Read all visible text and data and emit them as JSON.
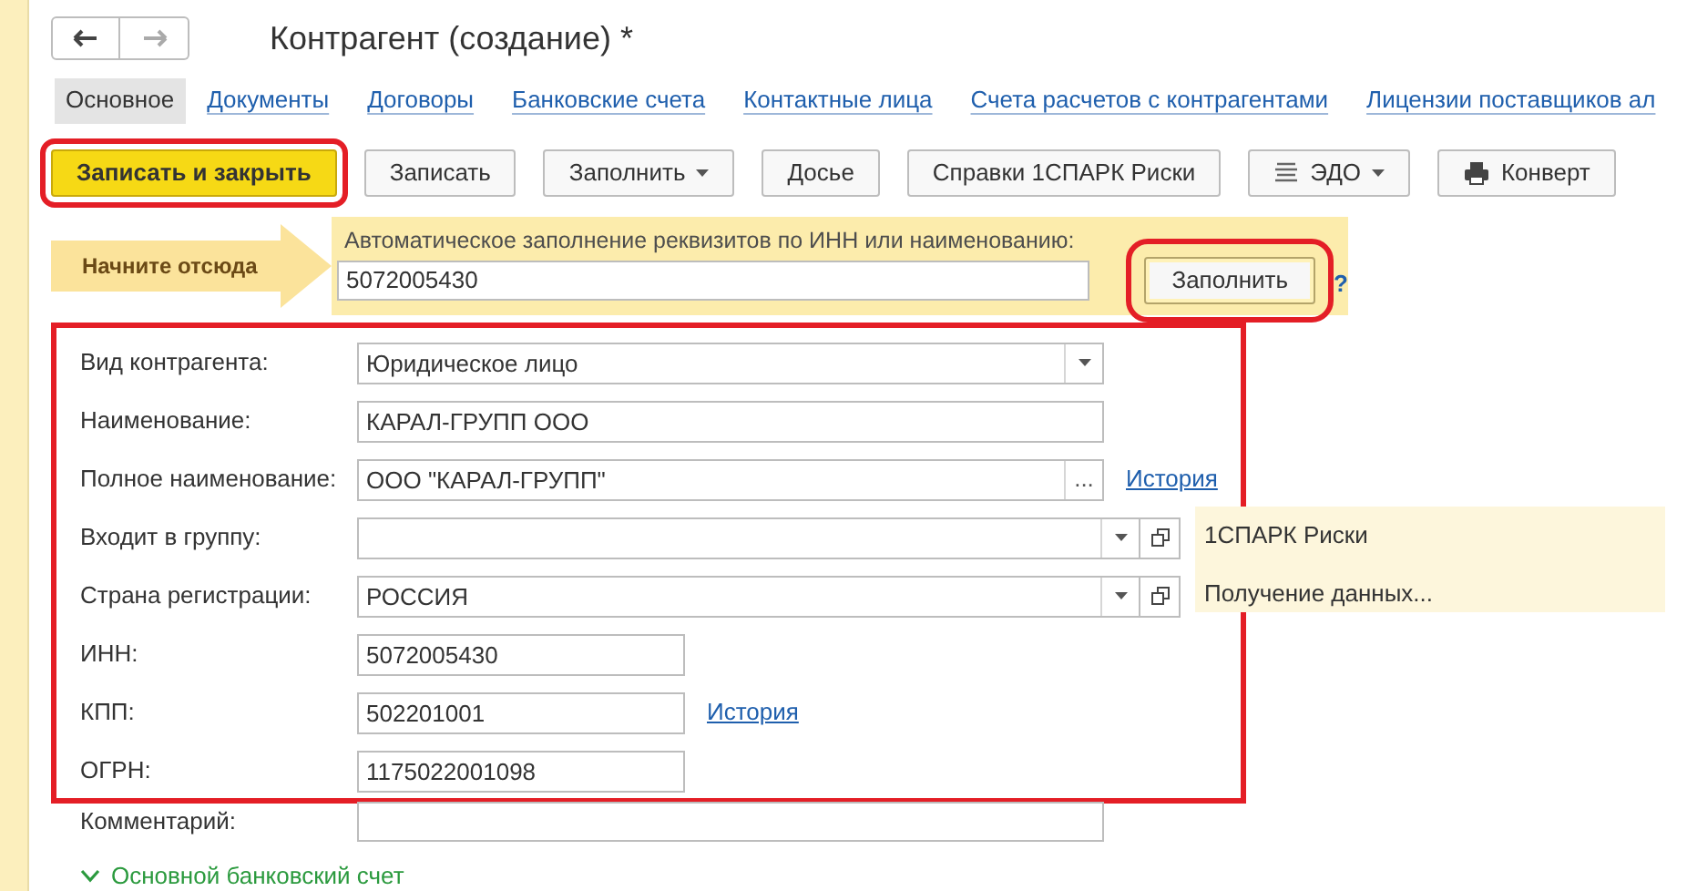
{
  "title": "Контрагент (создание) *",
  "tabs": [
    {
      "label": "Основное",
      "selected": true
    },
    {
      "label": "Документы",
      "selected": false
    },
    {
      "label": "Договоры",
      "selected": false
    },
    {
      "label": "Банковские счета",
      "selected": false
    },
    {
      "label": "Контактные лица",
      "selected": false
    },
    {
      "label": "Счета расчетов с контрагентами",
      "selected": false
    },
    {
      "label": "Лицензии поставщиков ал",
      "selected": false
    }
  ],
  "toolbar": [
    {
      "label": "Записать и закрыть",
      "kind": "primary",
      "highlighted": true
    },
    {
      "label": "Записать",
      "kind": "plain",
      "highlighted": false
    },
    {
      "label": "Заполнить",
      "kind": "dropdown",
      "highlighted": false
    },
    {
      "label": "Досье",
      "kind": "plain",
      "highlighted": false
    },
    {
      "label": "Справки 1СПАРК Риски",
      "kind": "plain",
      "highlighted": false
    },
    {
      "label": "ЭДО",
      "kind": "edo",
      "highlighted": false
    },
    {
      "label": "Конверт",
      "kind": "print",
      "highlighted": false
    }
  ],
  "autofill": {
    "arrow_label": "Начните отсюда",
    "caption": "Автоматическое заполнение реквизитов по ИНН или наименованию:",
    "value": "5072005430",
    "button": {
      "label": "Заполнить",
      "highlighted": true
    },
    "help": "?"
  },
  "form": {
    "highlighted": true,
    "rows": [
      {
        "label": "Вид контрагента:",
        "value": "Юридическое лицо",
        "kind": "select"
      },
      {
        "label": "Наименование:",
        "value": "КАРАЛ-ГРУПП ООО",
        "kind": "text"
      },
      {
        "label": "Полное наименование:",
        "value": "ООО \"КАРАЛ-ГРУПП\"",
        "kind": "ellipsis",
        "button": "...",
        "link": "История"
      },
      {
        "label": "Входит в группу:",
        "kind": "select_open"
      },
      {
        "label": "Страна регистрации:",
        "value": "РОССИЯ",
        "kind": "select_open"
      },
      {
        "label": "ИНН:",
        "value": "5072005430",
        "kind": "short"
      },
      {
        "label": "КПП:",
        "value": "502201001",
        "kind": "short",
        "link": "История"
      },
      {
        "label": "ОГРН:",
        "value": "1175022001098",
        "kind": "short"
      }
    ]
  },
  "comment": {
    "label": "Комментарий:"
  },
  "bank_section": {
    "label": "Основной банковский счет",
    "expanded": true
  },
  "spark_panel": {
    "title": "1СПАРК Риски",
    "status": "Получение данных..."
  }
}
